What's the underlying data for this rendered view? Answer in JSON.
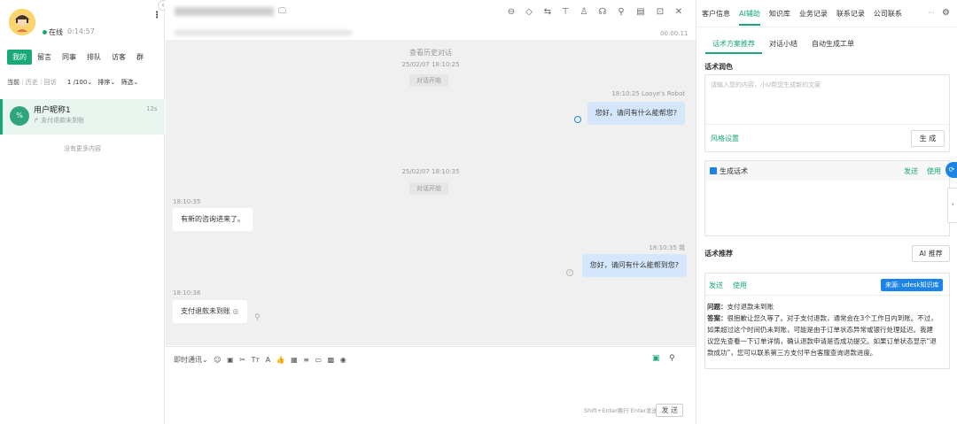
{
  "left": {
    "status_label": "在线",
    "status_time": "0:14:57",
    "tabs": [
      "我的",
      "留言",
      "同事",
      "排队",
      "访客",
      "群"
    ],
    "filter": {
      "current": "当前",
      "history": "历史",
      "recycle": "回访",
      "count": "1 /100",
      "sort": "排序",
      "filter": "筛选"
    },
    "conversation": {
      "name": "用户昵称1",
      "preview": "支付退款未到账",
      "age": "12s",
      "avatar_text": "%"
    },
    "no_more": "没有更多内容"
  },
  "main": {
    "timer": "00:00:11",
    "history_link": "查看历史对话",
    "ts1": "25/02/07 18:10:25",
    "pill1": "对话开始",
    "robot_meta": "18:10:25 Laoye's Robot",
    "robot_msg": "您好，请问有什么能帮您?",
    "ts2": "25/02/07 18:10:35",
    "pill2": "对话开始",
    "time_l1": "18:10:35",
    "user_msg1": "有新的咨询进来了。",
    "me_meta": "18:10:35 我",
    "me_msg": "您好，请问有什么能帮到您?",
    "time_l2": "18:10:36",
    "user_msg2": "支付退款未到账",
    "input_toolbar_label": "即时通讯",
    "send_hint": "Shift+Enter换行 Enter发送",
    "send_label": "发 送",
    "toolbar_icons": [
      "minus-circle-icon",
      "tag-icon",
      "transfer-icon",
      "pin-icon",
      "user-icon",
      "headset-icon",
      "user-search-icon",
      "note-icon",
      "lock-icon",
      "close-icon"
    ]
  },
  "right": {
    "tabs": [
      "客户信息",
      "AI辅助",
      "知识库",
      "业务记录",
      "联系记录",
      "公司联系"
    ],
    "active_tab": "AI辅助",
    "more": "···",
    "subtabs": [
      "话术方案推荐",
      "对话小结",
      "自动生成工单"
    ],
    "polish_title": "话术润色",
    "polish_placeholder": "请输入您的内容，小U帮您生成新的文案",
    "style_settings": "风格设置",
    "generate_btn": "生 成",
    "gen_title": "生成话术",
    "gen_send": "发送",
    "gen_use": "使用",
    "recommend_title": "话术推荐",
    "ai_recommend_btn": "AI 推荐",
    "rec_send": "发送",
    "rec_use": "使用",
    "source_badge": "来源: udesk知识库",
    "question_label": "问题：",
    "question": "支付退款未到账",
    "answer_label": "答案：",
    "answer": "很抱歉让您久等了。对于支付退款，通常会在3个工作日内到账。不过，如果超过这个时间仍未到账，可能是由于订单状态异常或银行处理延迟。我建议您先查看一下订单详情，确认退款申请是否成功提交。如果订单状态显示“退款成功”，您可以联系第三方支付平台客服查询退款进度。"
  }
}
